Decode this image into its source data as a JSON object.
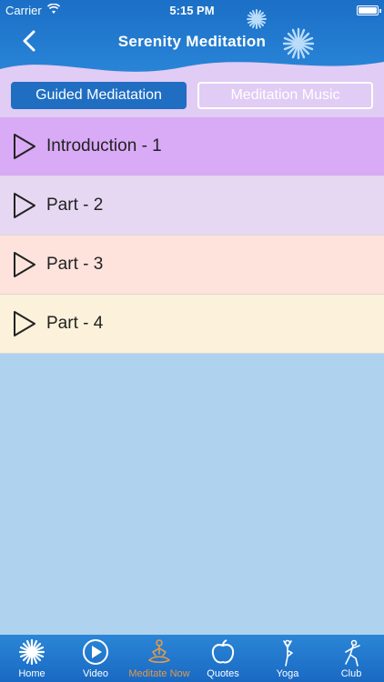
{
  "status_bar": {
    "carrier": "Carrier",
    "time": "5:15 PM"
  },
  "header": {
    "title": "Serenity Meditation"
  },
  "segments": {
    "active": "Guided Mediatation",
    "inactive": "Meditation Music"
  },
  "list": [
    {
      "label": "Introduction - 1",
      "color": "#d9aaf5"
    },
    {
      "label": "Part - 2",
      "color": "#e6d8f2"
    },
    {
      "label": "Part - 3",
      "color": "#fde3dc"
    },
    {
      "label": "Part - 4",
      "color": "#fcf1da"
    }
  ],
  "tabbar": {
    "items": [
      {
        "label": "Home",
        "icon": "lotus-flower-icon"
      },
      {
        "label": "Video",
        "icon": "play-circle-icon"
      },
      {
        "label": "Meditate Now",
        "icon": "meditation-pose-icon",
        "active": true
      },
      {
        "label": "Quotes",
        "icon": "apple-outline-icon"
      },
      {
        "label": "Yoga",
        "icon": "yoga-pose-icon"
      },
      {
        "label": "Club",
        "icon": "dance-pose-icon"
      }
    ]
  },
  "colors": {
    "header": "#1f77cf",
    "background": "#afd3ee",
    "accent_active": "#e39a4a"
  }
}
